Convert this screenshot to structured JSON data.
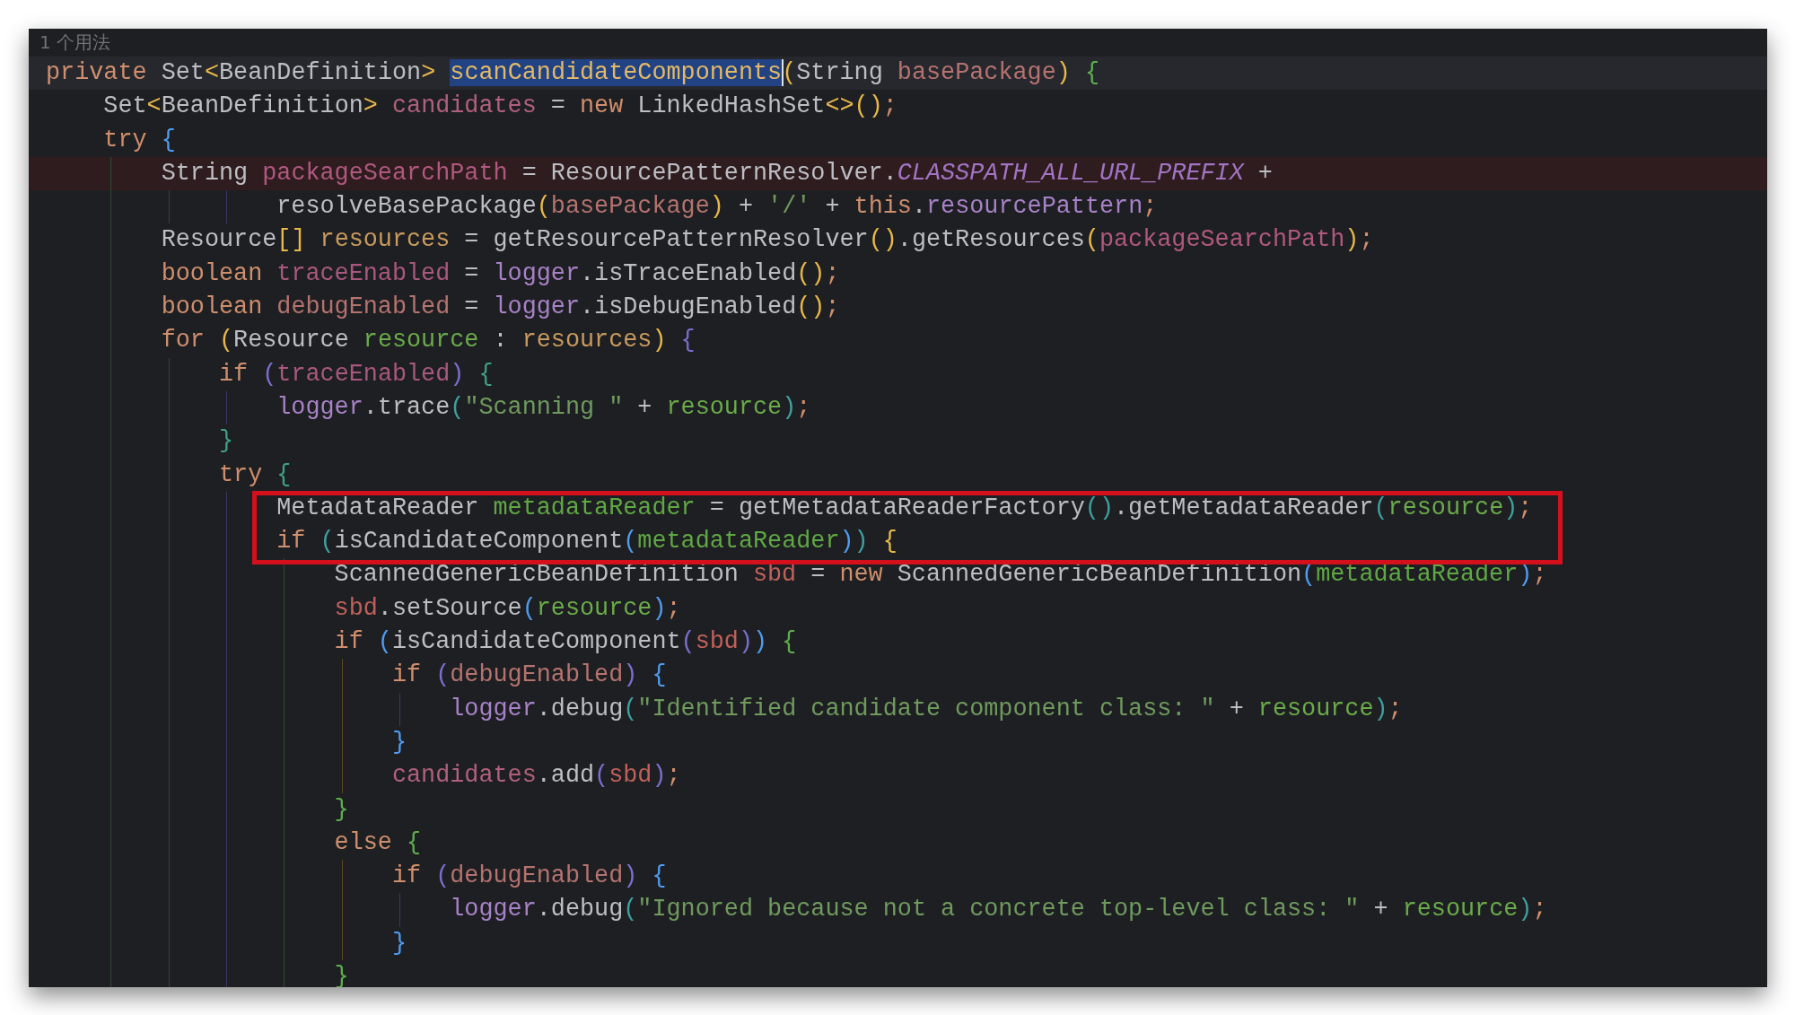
{
  "inlay_hint": "1 个用法",
  "lines": [
    {
      "kind": "code",
      "current": true,
      "marked": false,
      "boxed": false,
      "tokens": [
        {
          "kind": "kw",
          "text": "private "
        },
        {
          "kind": "txt",
          "text": "Set"
        },
        {
          "kind": "br",
          "color": "#e8b84a",
          "text": "<"
        },
        {
          "kind": "txt",
          "text": "BeanDefinition"
        },
        {
          "kind": "br",
          "color": "#e8b84a",
          "text": "> "
        },
        {
          "kind": "fn",
          "text": "scanCandidateComponents",
          "selected": true
        },
        {
          "kind": "br",
          "color": "#e8b84a",
          "text": "("
        },
        {
          "kind": "txt",
          "text": "String "
        },
        {
          "kind": "var",
          "color": "#b5736f",
          "text": "basePackage"
        },
        {
          "kind": "br",
          "color": "#e8b84a",
          "text": ") "
        },
        {
          "kind": "br",
          "color": "#5fae4e",
          "text": "{"
        }
      ],
      "children": [
        {
          "kind": "code",
          "current": false,
          "marked": false,
          "boxed": false,
          "tokens": [
            {
              "kind": "txt",
              "text": "Set"
            },
            {
              "kind": "br",
              "color": "#e8b84a",
              "text": "<"
            },
            {
              "kind": "txt",
              "text": "BeanDefinition"
            },
            {
              "kind": "br",
              "color": "#e8b84a",
              "text": "> "
            },
            {
              "kind": "var",
              "color": "#b0607a",
              "text": "candidates"
            },
            {
              "kind": "txt",
              "text": " = "
            },
            {
              "kind": "kw",
              "text": "new"
            },
            {
              "kind": "txt",
              "text": " LinkedHashSet"
            },
            {
              "kind": "br",
              "color": "#e8b84a",
              "text": "<>()"
            },
            {
              "kind": "kw",
              "text": ";"
            }
          ]
        },
        {
          "kind": "code",
          "current": false,
          "marked": false,
          "boxed": false,
          "tokens": [
            {
              "kind": "kw",
              "text": "try "
            },
            {
              "kind": "br",
              "color": "#4f9cf0",
              "text": "{"
            }
          ],
          "children": [
            {
              "kind": "code",
              "current": false,
              "marked": true,
              "boxed": false,
              "tokens": [
                {
                  "kind": "txt",
                  "text": "String "
                },
                {
                  "kind": "var",
                  "color": "#b0587f",
                  "text": "packageSearchPath"
                },
                {
                  "kind": "txt",
                  "text": " = ResourcePatternResolver."
                },
                {
                  "kind": "const",
                  "text": "CLASSPATH_ALL_URL_PREFIX"
                },
                {
                  "kind": "txt",
                  "text": " +"
                }
              ],
              "children": [
                {
                  "kind": "continuation",
                  "current": false,
                  "marked": false,
                  "boxed": false,
                  "tokens": [
                    {
                      "kind": "txt",
                      "text": "resolveBasePackage"
                    },
                    {
                      "kind": "br",
                      "color": "#e8b84a",
                      "text": "("
                    },
                    {
                      "kind": "var",
                      "color": "#b5736f",
                      "text": "basePackage"
                    },
                    {
                      "kind": "br",
                      "color": "#e8b84a",
                      "text": ")"
                    },
                    {
                      "kind": "txt",
                      "text": " + "
                    },
                    {
                      "kind": "str",
                      "text": "'/'"
                    },
                    {
                      "kind": "txt",
                      "text": " + "
                    },
                    {
                      "kind": "kw",
                      "text": "this"
                    },
                    {
                      "kind": "txt",
                      "text": "."
                    },
                    {
                      "kind": "mem",
                      "text": "resourcePattern"
                    },
                    {
                      "kind": "kw",
                      "text": ";"
                    }
                  ]
                }
              ]
            },
            {
              "kind": "code",
              "current": false,
              "marked": false,
              "boxed": false,
              "tokens": [
                {
                  "kind": "txt",
                  "text": "Resource"
                },
                {
                  "kind": "br",
                  "color": "#e8b84a",
                  "text": "[] "
                },
                {
                  "kind": "var",
                  "color": "#c99a5e",
                  "text": "resources"
                },
                {
                  "kind": "txt",
                  "text": " = getResourcePatternResolver"
                },
                {
                  "kind": "br",
                  "color": "#e8b84a",
                  "text": "()"
                },
                {
                  "kind": "txt",
                  "text": ".getResources"
                },
                {
                  "kind": "br",
                  "color": "#e8b84a",
                  "text": "("
                },
                {
                  "kind": "var",
                  "color": "#b0587f",
                  "text": "packageSearchPath"
                },
                {
                  "kind": "br",
                  "color": "#e8b84a",
                  "text": ")"
                },
                {
                  "kind": "kw",
                  "text": ";"
                }
              ]
            },
            {
              "kind": "code",
              "current": false,
              "marked": false,
              "boxed": false,
              "tokens": [
                {
                  "kind": "kw",
                  "text": "boolean "
                },
                {
                  "kind": "var",
                  "color": "#a8587e",
                  "text": "traceEnabled"
                },
                {
                  "kind": "txt",
                  "text": " = "
                },
                {
                  "kind": "mem",
                  "text": "logger"
                },
                {
                  "kind": "txt",
                  "text": ".isTraceEnabled"
                },
                {
                  "kind": "br",
                  "color": "#e8b84a",
                  "text": "()"
                },
                {
                  "kind": "kw",
                  "text": ";"
                }
              ]
            },
            {
              "kind": "code",
              "current": false,
              "marked": false,
              "boxed": false,
              "tokens": [
                {
                  "kind": "kw",
                  "text": "boolean "
                },
                {
                  "kind": "var",
                  "color": "#b5736f",
                  "text": "debugEnabled"
                },
                {
                  "kind": "txt",
                  "text": " = "
                },
                {
                  "kind": "mem",
                  "text": "logger"
                },
                {
                  "kind": "txt",
                  "text": ".isDebugEnabled"
                },
                {
                  "kind": "br",
                  "color": "#e8b84a",
                  "text": "()"
                },
                {
                  "kind": "kw",
                  "text": ";"
                }
              ]
            },
            {
              "kind": "code",
              "current": false,
              "marked": false,
              "boxed": false,
              "tokens": [
                {
                  "kind": "kw",
                  "text": "for "
                },
                {
                  "kind": "br",
                  "color": "#e8b84a",
                  "text": "("
                },
                {
                  "kind": "txt",
                  "text": "Resource "
                },
                {
                  "kind": "var",
                  "color": "#6aab4a",
                  "text": "resource"
                },
                {
                  "kind": "txt",
                  "text": " : "
                },
                {
                  "kind": "var",
                  "color": "#c99a5e",
                  "text": "resources"
                },
                {
                  "kind": "br",
                  "color": "#e8b84a",
                  "text": ") "
                },
                {
                  "kind": "br",
                  "color": "#7a6fd0",
                  "text": "{"
                }
              ],
              "children": [
                {
                  "kind": "code",
                  "current": false,
                  "marked": false,
                  "boxed": false,
                  "tokens": [
                    {
                      "kind": "kw",
                      "text": "if "
                    },
                    {
                      "kind": "br",
                      "color": "#7a6fd0",
                      "text": "("
                    },
                    {
                      "kind": "var",
                      "color": "#a8587e",
                      "text": "traceEnabled"
                    },
                    {
                      "kind": "br",
                      "color": "#7a6fd0",
                      "text": ") "
                    },
                    {
                      "kind": "br",
                      "color": "#3fa08a",
                      "text": "{"
                    }
                  ],
                  "children": [
                    {
                      "kind": "code",
                      "current": false,
                      "marked": false,
                      "boxed": false,
                      "tokens": [
                        {
                          "kind": "mem",
                          "text": "logger"
                        },
                        {
                          "kind": "txt",
                          "text": ".trace"
                        },
                        {
                          "kind": "br",
                          "color": "#3fa0a0",
                          "text": "("
                        },
                        {
                          "kind": "str",
                          "text": "\"Scanning \""
                        },
                        {
                          "kind": "txt",
                          "text": " + "
                        },
                        {
                          "kind": "var",
                          "color": "#6aab4a",
                          "text": "resource"
                        },
                        {
                          "kind": "br",
                          "color": "#3fa0a0",
                          "text": ")"
                        },
                        {
                          "kind": "kw",
                          "text": ";"
                        }
                      ]
                    }
                  ]
                },
                {
                  "kind": "code",
                  "current": false,
                  "marked": false,
                  "boxed": false,
                  "tokens": [
                    {
                      "kind": "br",
                      "color": "#3fa08a",
                      "text": "}"
                    }
                  ]
                },
                {
                  "kind": "code",
                  "current": false,
                  "marked": false,
                  "boxed": false,
                  "tokens": [
                    {
                      "kind": "kw",
                      "text": "try "
                    },
                    {
                      "kind": "br",
                      "color": "#3fa08a",
                      "text": "{"
                    }
                  ],
                  "children": [
                    {
                      "kind": "code",
                      "current": false,
                      "marked": false,
                      "boxed": true,
                      "tokens": [
                        {
                          "kind": "txt",
                          "text": "MetadataReader "
                        },
                        {
                          "kind": "var",
                          "color": "#5fa844",
                          "text": "metadataReader"
                        },
                        {
                          "kind": "txt",
                          "text": " = getMetadataReaderFactory"
                        },
                        {
                          "kind": "br",
                          "color": "#3fa0a0",
                          "text": "()"
                        },
                        {
                          "kind": "txt",
                          "text": ".getMetadataReader"
                        },
                        {
                          "kind": "br",
                          "color": "#3fa0a0",
                          "text": "("
                        },
                        {
                          "kind": "var",
                          "color": "#6aab4a",
                          "text": "resource"
                        },
                        {
                          "kind": "br",
                          "color": "#3fa0a0",
                          "text": ")"
                        },
                        {
                          "kind": "kw",
                          "text": ";"
                        }
                      ]
                    },
                    {
                      "kind": "code",
                      "current": false,
                      "marked": false,
                      "boxed": true,
                      "tokens": [
                        {
                          "kind": "kw",
                          "text": "if "
                        },
                        {
                          "kind": "br",
                          "color": "#3fa0a0",
                          "text": "("
                        },
                        {
                          "kind": "txt",
                          "text": "isCandidateComponent"
                        },
                        {
                          "kind": "br",
                          "color": "#4f9cf0",
                          "text": "("
                        },
                        {
                          "kind": "var",
                          "color": "#5fa844",
                          "text": "metadataReader"
                        },
                        {
                          "kind": "br",
                          "color": "#4f9cf0",
                          "text": ")"
                        },
                        {
                          "kind": "br",
                          "color": "#3fa0a0",
                          "text": ") "
                        },
                        {
                          "kind": "br",
                          "color": "#e8b84a",
                          "text": "{"
                        }
                      ],
                      "children": [
                        {
                          "kind": "code",
                          "current": false,
                          "marked": false,
                          "boxed": false,
                          "tokens": [
                            {
                              "kind": "txt",
                              "text": "ScannedGenericBeanDefinition "
                            },
                            {
                              "kind": "var",
                              "color": "#c0605a",
                              "text": "sbd"
                            },
                            {
                              "kind": "txt",
                              "text": " = "
                            },
                            {
                              "kind": "kw",
                              "text": "new"
                            },
                            {
                              "kind": "txt",
                              "text": " ScannedGenericBeanDefinition"
                            },
                            {
                              "kind": "br",
                              "color": "#4f9cf0",
                              "text": "("
                            },
                            {
                              "kind": "var",
                              "color": "#5fa844",
                              "text": "metadataReader"
                            },
                            {
                              "kind": "br",
                              "color": "#4f9cf0",
                              "text": ")"
                            },
                            {
                              "kind": "kw",
                              "text": ";"
                            }
                          ]
                        },
                        {
                          "kind": "code",
                          "current": false,
                          "marked": false,
                          "boxed": false,
                          "tokens": [
                            {
                              "kind": "var",
                              "color": "#c0605a",
                              "text": "sbd"
                            },
                            {
                              "kind": "txt",
                              "text": ".setSource"
                            },
                            {
                              "kind": "br",
                              "color": "#4f9cf0",
                              "text": "("
                            },
                            {
                              "kind": "var",
                              "color": "#6aab4a",
                              "text": "resource"
                            },
                            {
                              "kind": "br",
                              "color": "#4f9cf0",
                              "text": ")"
                            },
                            {
                              "kind": "kw",
                              "text": ";"
                            }
                          ]
                        },
                        {
                          "kind": "code",
                          "current": false,
                          "marked": false,
                          "boxed": false,
                          "tokens": [
                            {
                              "kind": "kw",
                              "text": "if "
                            },
                            {
                              "kind": "br",
                              "color": "#4f9cf0",
                              "text": "("
                            },
                            {
                              "kind": "txt",
                              "text": "isCandidateComponent"
                            },
                            {
                              "kind": "br",
                              "color": "#7a6fd0",
                              "text": "("
                            },
                            {
                              "kind": "var",
                              "color": "#c0605a",
                              "text": "sbd"
                            },
                            {
                              "kind": "br",
                              "color": "#7a6fd0",
                              "text": ")"
                            },
                            {
                              "kind": "br",
                              "color": "#4f9cf0",
                              "text": ") "
                            },
                            {
                              "kind": "br",
                              "color": "#5fae4e",
                              "text": "{"
                            }
                          ],
                          "children": [
                            {
                              "kind": "code",
                              "current": false,
                              "marked": false,
                              "boxed": false,
                              "tokens": [
                                {
                                  "kind": "kw",
                                  "text": "if "
                                },
                                {
                                  "kind": "br",
                                  "color": "#7a6fd0",
                                  "text": "("
                                },
                                {
                                  "kind": "var",
                                  "color": "#b5736f",
                                  "text": "debugEnabled"
                                },
                                {
                                  "kind": "br",
                                  "color": "#7a6fd0",
                                  "text": ") "
                                },
                                {
                                  "kind": "br",
                                  "color": "#4f9cf0",
                                  "text": "{"
                                }
                              ],
                              "children": [
                                {
                                  "kind": "code",
                                  "current": false,
                                  "marked": false,
                                  "boxed": false,
                                  "tokens": [
                                    {
                                      "kind": "mem",
                                      "text": "logger"
                                    },
                                    {
                                      "kind": "txt",
                                      "text": ".debug"
                                    },
                                    {
                                      "kind": "br",
                                      "color": "#3fa0a0",
                                      "text": "("
                                    },
                                    {
                                      "kind": "str",
                                      "text": "\"Identified candidate component class: \""
                                    },
                                    {
                                      "kind": "txt",
                                      "text": " + "
                                    },
                                    {
                                      "kind": "var",
                                      "color": "#6aab4a",
                                      "text": "resource"
                                    },
                                    {
                                      "kind": "br",
                                      "color": "#3fa0a0",
                                      "text": ")"
                                    },
                                    {
                                      "kind": "kw",
                                      "text": ";"
                                    }
                                  ]
                                }
                              ]
                            },
                            {
                              "kind": "code",
                              "current": false,
                              "marked": false,
                              "boxed": false,
                              "tokens": [
                                {
                                  "kind": "br",
                                  "color": "#4f9cf0",
                                  "text": "}"
                                }
                              ]
                            },
                            {
                              "kind": "code",
                              "current": false,
                              "marked": false,
                              "boxed": false,
                              "tokens": [
                                {
                                  "kind": "var",
                                  "color": "#b0607a",
                                  "text": "candidates"
                                },
                                {
                                  "kind": "txt",
                                  "text": ".add"
                                },
                                {
                                  "kind": "br",
                                  "color": "#7a6fd0",
                                  "text": "("
                                },
                                {
                                  "kind": "var",
                                  "color": "#c0605a",
                                  "text": "sbd"
                                },
                                {
                                  "kind": "br",
                                  "color": "#7a6fd0",
                                  "text": ")"
                                },
                                {
                                  "kind": "kw",
                                  "text": ";"
                                }
                              ]
                            }
                          ]
                        },
                        {
                          "kind": "code",
                          "current": false,
                          "marked": false,
                          "boxed": false,
                          "tokens": [
                            {
                              "kind": "br",
                              "color": "#5fae4e",
                              "text": "}"
                            }
                          ]
                        },
                        {
                          "kind": "code",
                          "current": false,
                          "marked": false,
                          "boxed": false,
                          "tokens": [
                            {
                              "kind": "kw",
                              "text": "else "
                            },
                            {
                              "kind": "br",
                              "color": "#5fae4e",
                              "text": "{"
                            }
                          ],
                          "children": [
                            {
                              "kind": "code",
                              "current": false,
                              "marked": false,
                              "boxed": false,
                              "tokens": [
                                {
                                  "kind": "kw",
                                  "text": "if "
                                },
                                {
                                  "kind": "br",
                                  "color": "#7a6fd0",
                                  "text": "("
                                },
                                {
                                  "kind": "var",
                                  "color": "#b5736f",
                                  "text": "debugEnabled"
                                },
                                {
                                  "kind": "br",
                                  "color": "#7a6fd0",
                                  "text": ") "
                                },
                                {
                                  "kind": "br",
                                  "color": "#4f9cf0",
                                  "text": "{"
                                }
                              ],
                              "children": [
                                {
                                  "kind": "code",
                                  "current": false,
                                  "marked": false,
                                  "boxed": false,
                                  "tokens": [
                                    {
                                      "kind": "mem",
                                      "text": "logger"
                                    },
                                    {
                                      "kind": "txt",
                                      "text": ".debug"
                                    },
                                    {
                                      "kind": "br",
                                      "color": "#3fa0a0",
                                      "text": "("
                                    },
                                    {
                                      "kind": "str",
                                      "text": "\"Ignored because not a concrete top-level class: \""
                                    },
                                    {
                                      "kind": "txt",
                                      "text": " + "
                                    },
                                    {
                                      "kind": "var",
                                      "color": "#6aab4a",
                                      "text": "resource"
                                    },
                                    {
                                      "kind": "br",
                                      "color": "#3fa0a0",
                                      "text": ")"
                                    },
                                    {
                                      "kind": "kw",
                                      "text": ";"
                                    }
                                  ]
                                }
                              ]
                            },
                            {
                              "kind": "code",
                              "current": false,
                              "marked": false,
                              "boxed": false,
                              "tokens": [
                                {
                                  "kind": "br",
                                  "color": "#4f9cf0",
                                  "text": "}"
                                }
                              ]
                            }
                          ]
                        },
                        {
                          "kind": "code",
                          "current": false,
                          "marked": false,
                          "boxed": false,
                          "tokens": [
                            {
                              "kind": "br",
                              "color": "#5fae4e",
                              "text": "}"
                            }
                          ]
                        }
                      ]
                    }
                  ]
                }
              ]
            }
          ]
        }
      ]
    }
  ]
}
